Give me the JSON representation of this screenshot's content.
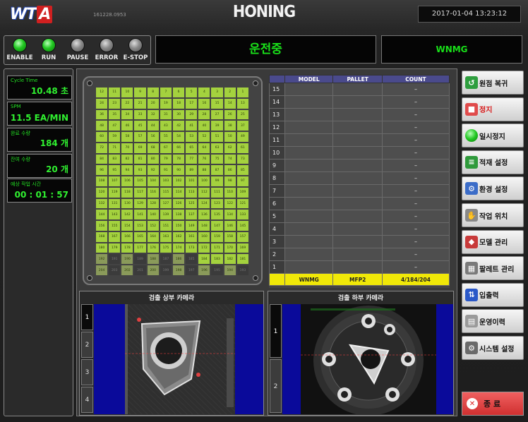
{
  "header": {
    "logo_left": "WT",
    "logo_right": "A",
    "version": "161228.0953",
    "title": "HONING",
    "datetime": "2017-01-04 13:23:12"
  },
  "lamps": [
    {
      "label": "ENABLE",
      "state": "on"
    },
    {
      "label": "RUN",
      "state": "on"
    },
    {
      "label": "PAUSE",
      "state": "off"
    },
    {
      "label": "ERROR",
      "state": "off"
    },
    {
      "label": "E-STOP",
      "state": "off"
    }
  ],
  "status_text": "운전중",
  "model_text": "WNMG",
  "stats": [
    {
      "key": "Cycle Time",
      "value": "10.48 초"
    },
    {
      "key": "SPM",
      "value": "11.5 EA/MIN"
    },
    {
      "key": "완료 수량",
      "value": "184 개"
    },
    {
      "key": "잔여 수량",
      "value": "20 개"
    },
    {
      "key": "예상 작업 시간",
      "value": "00 : 01 : 57"
    }
  ],
  "tray": {
    "cols": 12,
    "rows": 17,
    "completed": 184,
    "total": 204
  },
  "rack": {
    "headers": {
      "no": "",
      "model": "MODEL",
      "pallet": "PALLET",
      "count": "COUNT"
    },
    "rows": [
      {
        "no": "15",
        "model": "",
        "pallet": "",
        "count": "–"
      },
      {
        "no": "14",
        "model": "",
        "pallet": "",
        "count": "–"
      },
      {
        "no": "13",
        "model": "",
        "pallet": "",
        "count": "–"
      },
      {
        "no": "12",
        "model": "",
        "pallet": "",
        "count": "–"
      },
      {
        "no": "11",
        "model": "",
        "pallet": "",
        "count": "–"
      },
      {
        "no": "10",
        "model": "",
        "pallet": "",
        "count": "–"
      },
      {
        "no": "9",
        "model": "",
        "pallet": "",
        "count": "–"
      },
      {
        "no": "8",
        "model": "",
        "pallet": "",
        "count": "–"
      },
      {
        "no": "7",
        "model": "",
        "pallet": "",
        "count": "–"
      },
      {
        "no": "6",
        "model": "",
        "pallet": "",
        "count": "–"
      },
      {
        "no": "5",
        "model": "",
        "pallet": "",
        "count": "–"
      },
      {
        "no": "4",
        "model": "",
        "pallet": "",
        "count": "–"
      },
      {
        "no": "3",
        "model": "",
        "pallet": "",
        "count": "–"
      },
      {
        "no": "2",
        "model": "",
        "pallet": "",
        "count": "–"
      },
      {
        "no": "1",
        "model": "",
        "pallet": "",
        "count": "–"
      }
    ],
    "footer": {
      "model": "WNMG",
      "pallet": "MFP2",
      "count": "4/184/204"
    }
  },
  "cameras": {
    "top": {
      "title": "검출 상부 카메라",
      "tabs": [
        "1",
        "2",
        "3",
        "4"
      ]
    },
    "bottom": {
      "title": "검출 하부 카메라",
      "tabs": [
        "1",
        "2"
      ]
    }
  },
  "side_buttons": [
    {
      "label": "원점 복귀",
      "icon": "home-return-icon",
      "color": "#2e9e3e",
      "glyph": "↺"
    },
    {
      "label": "정지",
      "icon": "stop-icon",
      "color": "#e04b4b",
      "glyph": "■"
    },
    {
      "label": "일시정지",
      "icon": "pause-icon",
      "color": "#20c020",
      "glyph": ""
    },
    {
      "label": "적재 설정",
      "icon": "stack-settings-icon",
      "color": "#2f9a3b",
      "glyph": "≡"
    },
    {
      "label": "환경 설정",
      "icon": "environment-settings-icon",
      "color": "#3b6cc8",
      "glyph": "⚙"
    },
    {
      "label": "작업 위치",
      "icon": "hand-position-icon",
      "color": "#888888",
      "glyph": "✋"
    },
    {
      "label": "모델 관리",
      "icon": "model-management-icon",
      "color": "#c83a3a",
      "glyph": "◆"
    },
    {
      "label": "팔레트 관리",
      "icon": "pallet-management-icon",
      "color": "#7a7a7a",
      "glyph": "▦"
    },
    {
      "label": "입출력",
      "icon": "io-icon",
      "color": "#2a58c8",
      "glyph": "⇅"
    },
    {
      "label": "운영이력",
      "icon": "history-icon",
      "color": "#9a9a9a",
      "glyph": "▤"
    },
    {
      "label": "시스템 설정",
      "icon": "system-settings-icon",
      "color": "#6a6a6a",
      "glyph": "⚙"
    }
  ],
  "exit_button": {
    "label": "종 료",
    "icon": "exit-icon",
    "glyph": "✕"
  }
}
